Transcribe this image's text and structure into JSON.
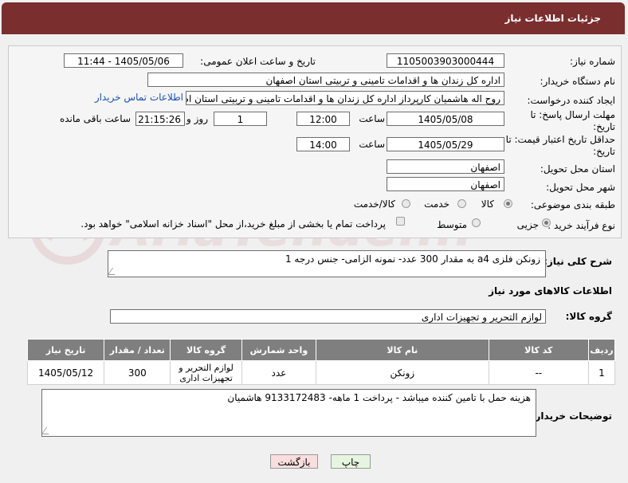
{
  "header": {
    "title": "جزئیات اطلاعات نیاز"
  },
  "form": {
    "need_number": {
      "label": "شماره نیاز:",
      "value": "1105003903000444"
    },
    "announce_datetime": {
      "label": "تاریخ و ساعت اعلان عمومی:",
      "value": "1405/05/06 - 11:44"
    },
    "buyer_org": {
      "label": "نام دستگاه خریدار:",
      "value": "اداره کل زندان ها و اقدامات تامینی و تربیتی استان اصفهان"
    },
    "requester": {
      "label": "ایجاد کننده درخواست:",
      "value": "روح اله هاشمیان کارپرداز اداره کل زندان ها و اقدامات تامینی و تربیتی استان اصفهان",
      "contact_link": "اطلاعات تماس خریدار"
    },
    "reply_deadline": {
      "label": "مهلت ارسال پاسخ: تا تاریخ:",
      "date": "1405/05/08",
      "time_label": "ساعت",
      "time": "12:00",
      "days": "1",
      "days_label": "روز و",
      "remaining": "21:15:26",
      "remaining_label": "ساعت باقی مانده"
    },
    "price_validity": {
      "label": "حداقل تاریخ اعتبار قیمت: تا تاریخ:",
      "date": "1405/05/29",
      "time_label": "ساعت",
      "time": "14:00"
    },
    "delivery_province": {
      "label": "استان محل تحویل:",
      "value": "اصفهان"
    },
    "delivery_city": {
      "label": "شهر محل تحویل:",
      "value": "اصفهان"
    },
    "category": {
      "label": "طبقه بندی موضوعی:",
      "options": [
        "کالا",
        "خدمت",
        "کالا/خدمت"
      ],
      "selected": "کالا"
    },
    "purchase_process": {
      "label": "نوع فرآیند خرید :",
      "options": [
        "جزیی",
        "متوسط"
      ],
      "selected": "جزیی",
      "payment_note": "پرداخت تمام یا بخشی از مبلغ خرید،از محل \"اسناد خزانه اسلامی\" خواهد بود."
    }
  },
  "description": {
    "label": "شرح کلی نیاز:",
    "value": "زونکن فلزی a4 به مقدار 300 عدد- نمونه الزامی- جنس درجه 1"
  },
  "goods_section": {
    "title": "اطلاعات کالاهای مورد نیاز"
  },
  "goods_group": {
    "label": "گروه کالا:",
    "value": "لوازم التحریر و تجهیزات اداری"
  },
  "table": {
    "columns": [
      "ردیف",
      "کد کالا",
      "نام کالا",
      "واحد شمارش",
      "گروه کالا",
      "تعداد / مقدار",
      "تاریخ نیاز"
    ],
    "rows": [
      [
        "1",
        "--",
        "زونکن",
        "عدد",
        "لوازم التحریر و تجهیزات اداری",
        "300",
        "1405/05/12"
      ]
    ]
  },
  "buyer_notes": {
    "label": "توضیحات خریدار:",
    "value": "هزینه حمل با تامین کننده میباشد - پرداخت 1 ماهه- 9133172483 هاشمیان"
  },
  "buttons": {
    "print": "چاپ",
    "back": "بازگشت"
  },
  "watermark": {
    "text": "AriaTender.net"
  }
}
